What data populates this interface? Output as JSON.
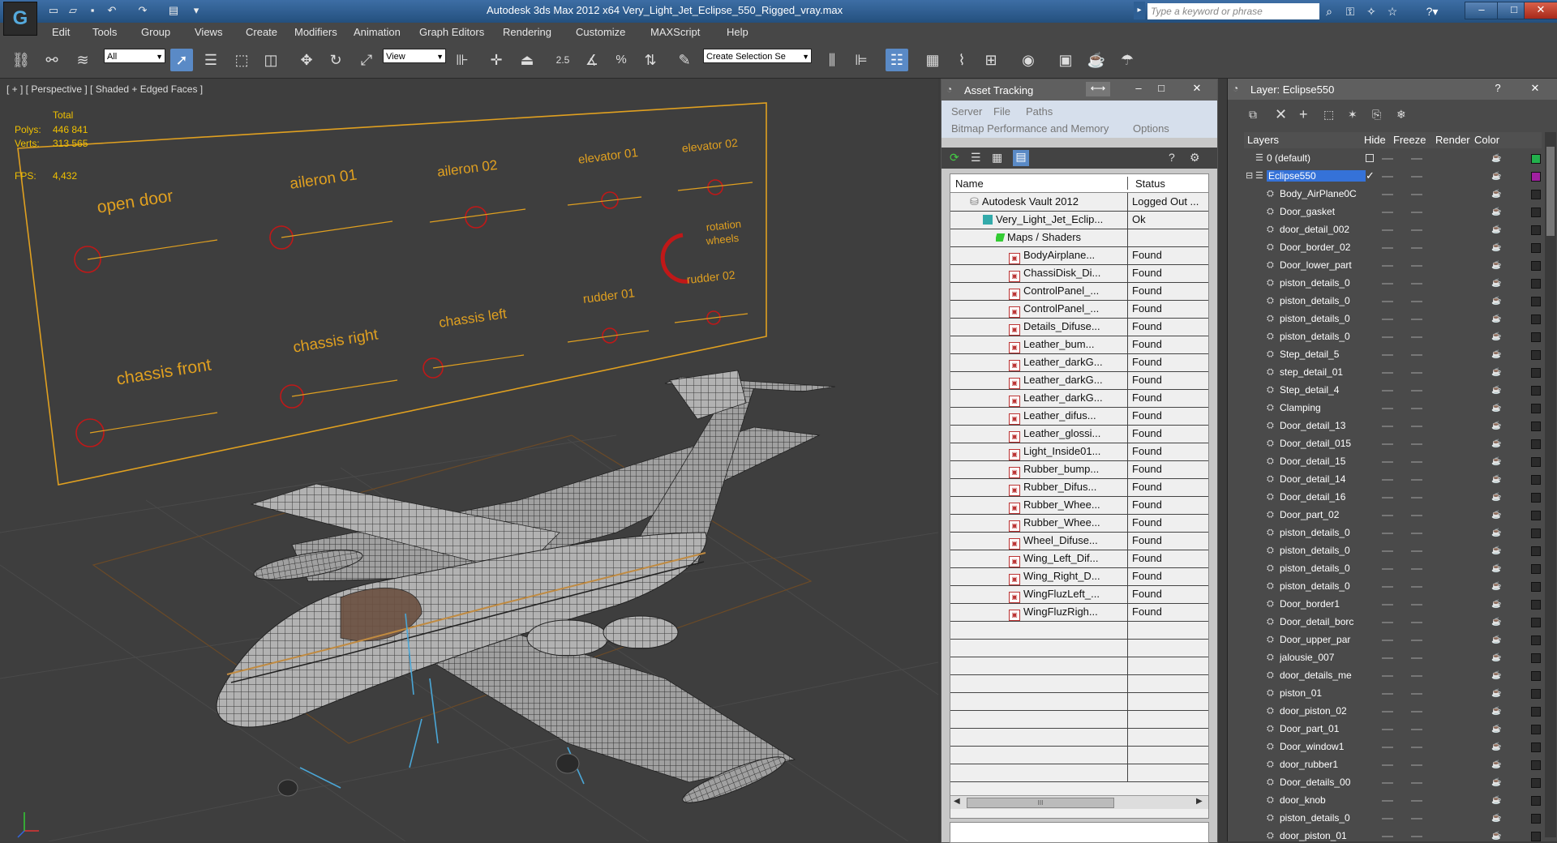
{
  "titlebar": {
    "title": "Autodesk 3ds Max  2012 x64      Very_Light_Jet_Eclipse_550_Rigged_vray.max",
    "search_placeholder": "Type a keyword or phrase"
  },
  "menu": [
    "Edit",
    "Tools",
    "Group",
    "Views",
    "Create",
    "Modifiers",
    "Animation",
    "Graph Editors",
    "Rendering",
    "Customize",
    "MAXScript",
    "Help"
  ],
  "toolbar": {
    "selection_filter": "All",
    "reference_coord": "View",
    "snap_value": "2.5",
    "percent_snap": "%",
    "selection_set": "Create Selection Se"
  },
  "viewport": {
    "label": "[ + ] [ Perspective ] [ Shaded + Edged Faces ]",
    "stats": {
      "total_label": "Total",
      "polys_label": "Polys:",
      "polys": "446 841",
      "verts_label": "Verts:",
      "verts": "313 565",
      "fps_label": "FPS:",
      "fps": "4,432"
    },
    "rig_labels": {
      "open_door": "open door",
      "aileron_01": "aileron 01",
      "aileron_02": "aileron 02",
      "elevator_01": "elevator 01",
      "elevator_02": "elevator 02",
      "rotation_wheels_1": "rotation",
      "rotation_wheels_2": "wheels",
      "chassis_front": "chassis front",
      "chassis_right": "chassis right",
      "chassis_left": "chassis left",
      "rudder_01": "rudder 01",
      "rudder_02": "rudder 02"
    }
  },
  "asset_tracking": {
    "title": "Asset Tracking",
    "menu_row1": [
      "Server",
      "File",
      "Paths"
    ],
    "menu_row2": [
      "Bitmap Performance and Memory",
      "Options"
    ],
    "col_name": "Name",
    "col_status": "Status",
    "rows": [
      {
        "name": "Autodesk Vault 2012",
        "status": "Logged Out ..."
      },
      {
        "name": "Very_Light_Jet_Eclip...",
        "status": "Ok"
      },
      {
        "name": "Maps / Shaders",
        "status": ""
      },
      {
        "name": "BodyAirplane...",
        "status": "Found"
      },
      {
        "name": "ChassiDisk_Di...",
        "status": "Found"
      },
      {
        "name": "ControlPanel_...",
        "status": "Found"
      },
      {
        "name": "ControlPanel_...",
        "status": "Found"
      },
      {
        "name": "Details_Difuse...",
        "status": "Found"
      },
      {
        "name": "Leather_bum...",
        "status": "Found"
      },
      {
        "name": "Leather_darkG...",
        "status": "Found"
      },
      {
        "name": "Leather_darkG...",
        "status": "Found"
      },
      {
        "name": "Leather_darkG...",
        "status": "Found"
      },
      {
        "name": "Leather_difus...",
        "status": "Found"
      },
      {
        "name": "Leather_glossi...",
        "status": "Found"
      },
      {
        "name": "Light_Inside01...",
        "status": "Found"
      },
      {
        "name": "Rubber_bump...",
        "status": "Found"
      },
      {
        "name": "Rubber_Difus...",
        "status": "Found"
      },
      {
        "name": "Rubber_Whee...",
        "status": "Found"
      },
      {
        "name": "Rubber_Whee...",
        "status": "Found"
      },
      {
        "name": "Wheel_Difuse...",
        "status": "Found"
      },
      {
        "name": "Wing_Left_Dif...",
        "status": "Found"
      },
      {
        "name": "Wing_Right_D...",
        "status": "Found"
      },
      {
        "name": "WingFluzLeft_...",
        "status": "Found"
      },
      {
        "name": "WingFluzRigh...",
        "status": "Found"
      }
    ],
    "scroll_grip": "III"
  },
  "layer_panel": {
    "title": "Layer: Eclipse550",
    "cols": {
      "layers": "Layers",
      "hide": "Hide",
      "freeze": "Freeze",
      "render": "Render",
      "color": "Color"
    },
    "rows": [
      {
        "name": "0 (default)",
        "kind": "layer",
        "color": "#22b14c"
      },
      {
        "name": "Eclipse550",
        "kind": "layer",
        "color": "#a020a0",
        "selected": true
      },
      {
        "name": "Body_AirPlane0C",
        "kind": "obj"
      },
      {
        "name": "Door_gasket",
        "kind": "obj"
      },
      {
        "name": "door_detail_002",
        "kind": "obj"
      },
      {
        "name": "Door_border_02",
        "kind": "obj"
      },
      {
        "name": "Door_lower_part",
        "kind": "obj"
      },
      {
        "name": "piston_details_0",
        "kind": "obj"
      },
      {
        "name": "piston_details_0",
        "kind": "obj"
      },
      {
        "name": "piston_details_0",
        "kind": "obj"
      },
      {
        "name": "piston_details_0",
        "kind": "obj"
      },
      {
        "name": "Step_detail_5",
        "kind": "obj"
      },
      {
        "name": "step_detail_01",
        "kind": "obj"
      },
      {
        "name": "Step_detail_4",
        "kind": "obj"
      },
      {
        "name": "Clamping",
        "kind": "obj"
      },
      {
        "name": "Door_detail_13",
        "kind": "obj"
      },
      {
        "name": "Door_detail_015",
        "kind": "obj"
      },
      {
        "name": "Door_detail_15",
        "kind": "obj"
      },
      {
        "name": "Door_detail_14",
        "kind": "obj"
      },
      {
        "name": "Door_detail_16",
        "kind": "obj"
      },
      {
        "name": "Door_part_02",
        "kind": "obj"
      },
      {
        "name": "piston_details_0",
        "kind": "obj"
      },
      {
        "name": "piston_details_0",
        "kind": "obj"
      },
      {
        "name": "piston_details_0",
        "kind": "obj"
      },
      {
        "name": "piston_details_0",
        "kind": "obj"
      },
      {
        "name": "Door_border1",
        "kind": "obj"
      },
      {
        "name": "Door_detail_borc",
        "kind": "obj"
      },
      {
        "name": "Door_upper_par",
        "kind": "obj"
      },
      {
        "name": "jalousie_007",
        "kind": "obj"
      },
      {
        "name": "door_details_me",
        "kind": "obj"
      },
      {
        "name": "piston_01",
        "kind": "obj"
      },
      {
        "name": "door_piston_02",
        "kind": "obj"
      },
      {
        "name": "Door_part_01",
        "kind": "obj"
      },
      {
        "name": "Door_window1",
        "kind": "obj"
      },
      {
        "name": "door_rubber1",
        "kind": "obj"
      },
      {
        "name": "Door_details_00",
        "kind": "obj"
      },
      {
        "name": "door_knob",
        "kind": "obj"
      },
      {
        "name": "piston_details_0",
        "kind": "obj"
      },
      {
        "name": "door_piston_01",
        "kind": "obj"
      }
    ]
  },
  "colors": {
    "accent": "#3a73c4",
    "rig": "#e0a020",
    "rig_circle": "#c01818",
    "selected_row": "#3572d8"
  }
}
